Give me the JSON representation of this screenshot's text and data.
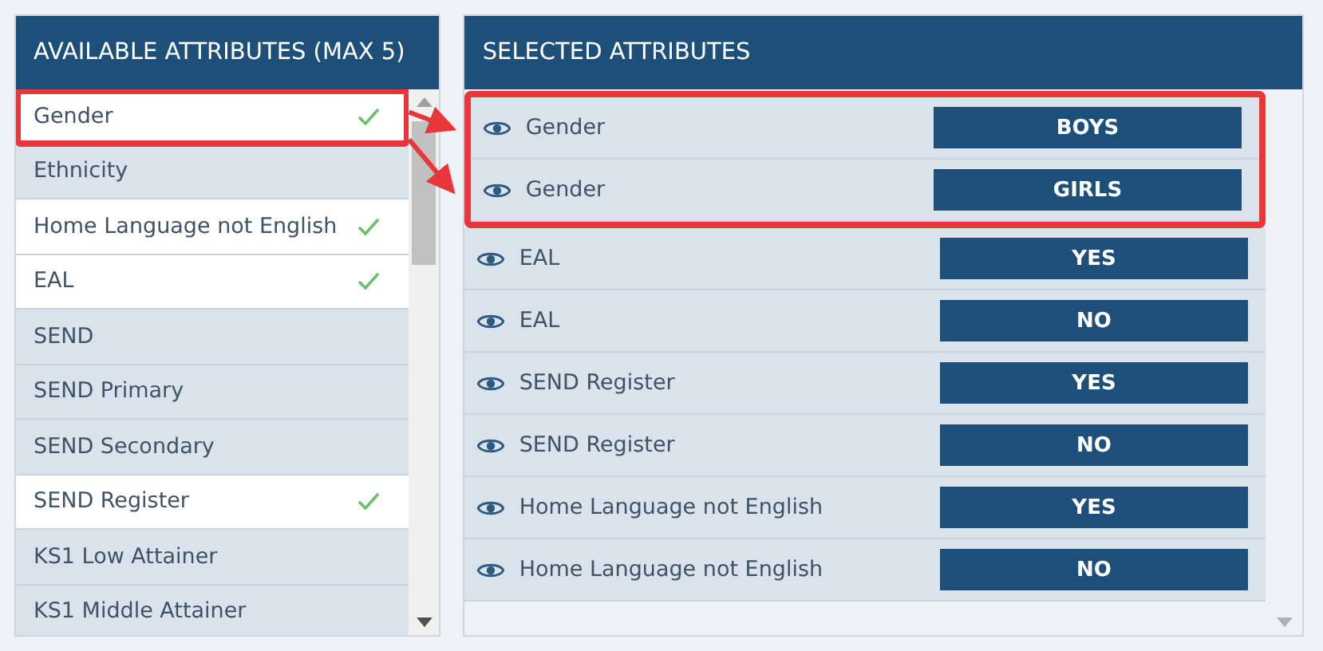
{
  "available": {
    "title": "AVAILABLE ATTRIBUTES (MAX 5)",
    "items": [
      {
        "label": "Gender",
        "checked": true,
        "highlighted": true
      },
      {
        "label": "Ethnicity",
        "checked": false,
        "highlighted": false
      },
      {
        "label": "Home Language not English",
        "checked": true,
        "highlighted": false
      },
      {
        "label": "EAL",
        "checked": true,
        "highlighted": false
      },
      {
        "label": "SEND",
        "checked": false,
        "highlighted": false
      },
      {
        "label": "SEND Primary",
        "checked": false,
        "highlighted": false
      },
      {
        "label": "SEND Secondary",
        "checked": false,
        "highlighted": false
      },
      {
        "label": "SEND Register",
        "checked": true,
        "highlighted": false
      },
      {
        "label": "KS1 Low Attainer",
        "checked": false,
        "highlighted": false
      },
      {
        "label": "KS1 Middle Attainer",
        "checked": false,
        "highlighted": false
      }
    ]
  },
  "selected": {
    "title": "SELECTED ATTRIBUTES",
    "rows": [
      {
        "name": "Gender",
        "value": "BOYS",
        "highlighted": true
      },
      {
        "name": "Gender",
        "value": "GIRLS",
        "highlighted": true
      },
      {
        "name": "EAL",
        "value": "YES",
        "highlighted": false
      },
      {
        "name": "EAL",
        "value": "NO",
        "highlighted": false
      },
      {
        "name": "SEND Register",
        "value": "YES",
        "highlighted": false
      },
      {
        "name": "SEND Register",
        "value": "NO",
        "highlighted": false
      },
      {
        "name": "Home Language not English",
        "value": "YES",
        "highlighted": false
      },
      {
        "name": "Home Language not English",
        "value": "NO",
        "highlighted": false
      }
    ]
  }
}
